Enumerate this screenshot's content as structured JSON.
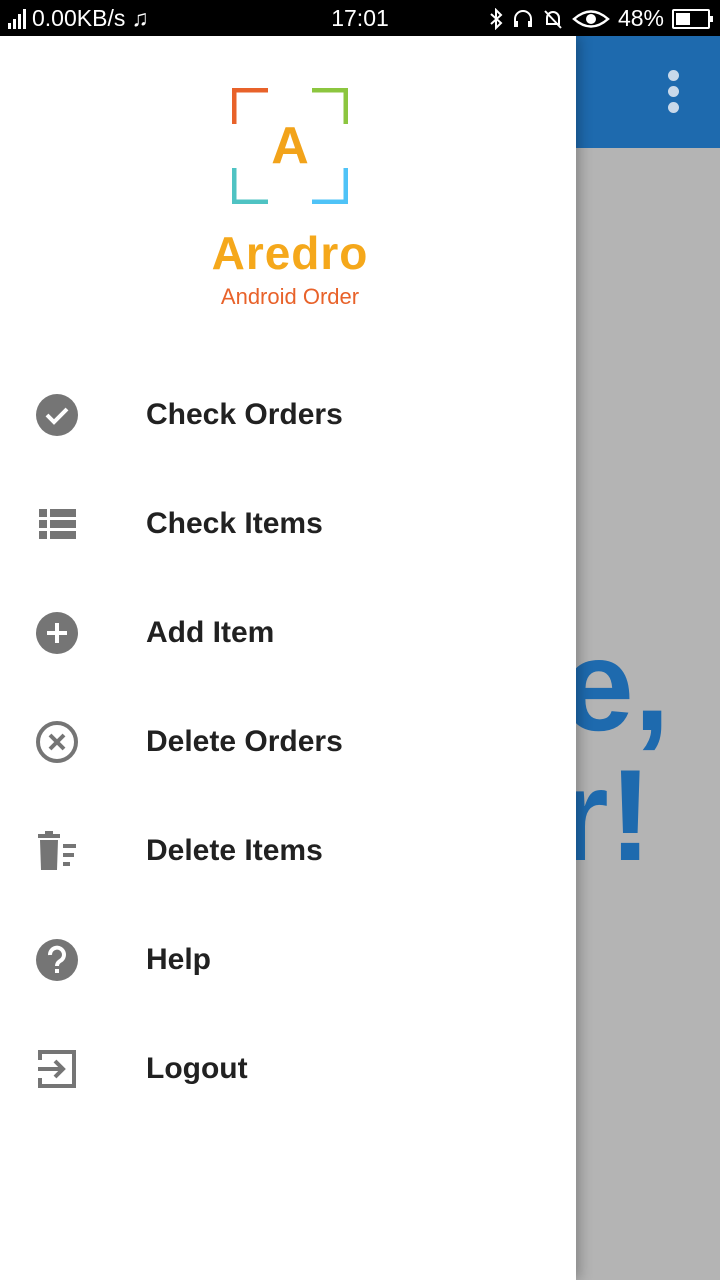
{
  "status_bar": {
    "network_speed": "0.00KB/s",
    "time": "17:01",
    "battery_percent": "48%",
    "battery_level": 0.48
  },
  "background": {
    "overflow_menu_icon": "more-vert-icon",
    "partial_text_line1": "e,",
    "partial_text_line2": "r!"
  },
  "drawer": {
    "logo": {
      "letter": "A",
      "name": "Aredro",
      "subtitle": "Android Order"
    },
    "items": [
      {
        "label": "Check Orders",
        "icon": "check-circle-icon"
      },
      {
        "label": "Check Items",
        "icon": "list-icon"
      },
      {
        "label": "Add Item",
        "icon": "add-circle-icon"
      },
      {
        "label": "Delete Orders",
        "icon": "cancel-circle-icon"
      },
      {
        "label": "Delete Items",
        "icon": "delete-sweep-icon"
      },
      {
        "label": "Help",
        "icon": "help-circle-icon"
      },
      {
        "label": "Logout",
        "icon": "exit-icon"
      }
    ]
  },
  "colors": {
    "app_bar": "#1e6aae",
    "icon_gray": "#757575",
    "logo_orange": "#f5a81b",
    "logo_subtitle": "#e8622a"
  }
}
